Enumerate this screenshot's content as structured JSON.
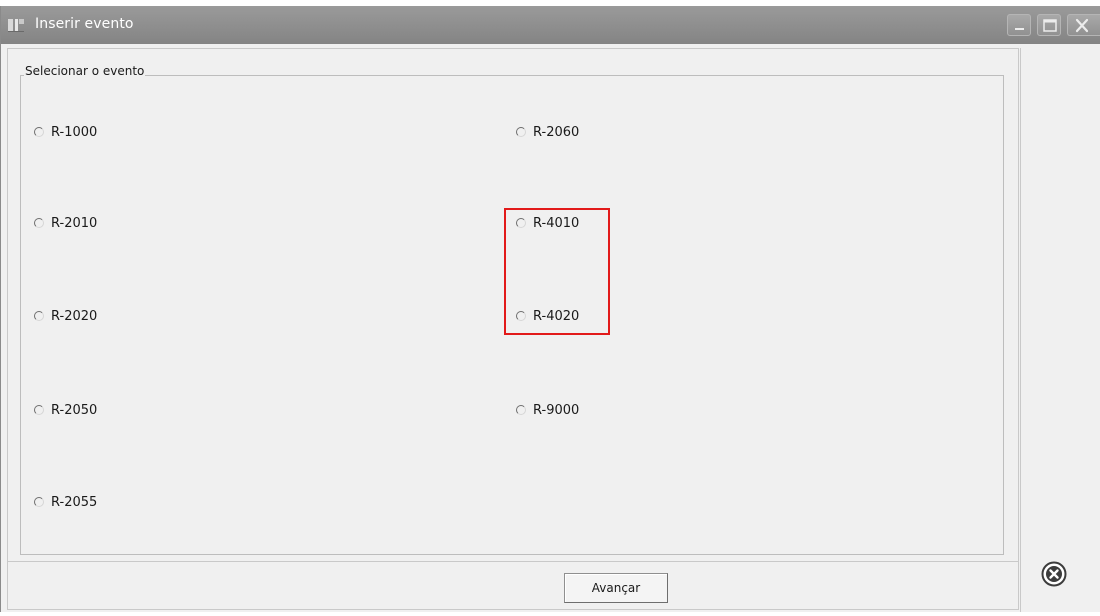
{
  "window": {
    "title": "Inserir evento",
    "icons": {
      "app": "app-logo-icon",
      "minimize": "minimize-icon",
      "maximize": "maximize-icon",
      "close": "close-icon",
      "cancel": "close-circle-icon"
    }
  },
  "group": {
    "legend": "Selecionar o evento"
  },
  "events": {
    "left": [
      {
        "label": "R-1000",
        "selected": false
      },
      {
        "label": "R-2010",
        "selected": false
      },
      {
        "label": "R-2020",
        "selected": false
      },
      {
        "label": "R-2050",
        "selected": false
      },
      {
        "label": "R-2055",
        "selected": false
      }
    ],
    "right": [
      {
        "label": "R-2060",
        "selected": false
      },
      {
        "label": "R-4010",
        "selected": false
      },
      {
        "label": "R-4020",
        "selected": false
      },
      {
        "label": "R-9000",
        "selected": false
      }
    ]
  },
  "footer": {
    "advance_label": "Avançar"
  },
  "colors": {
    "titlebar": "#8d8d8d",
    "highlight": "#e21a1a",
    "background": "#f0f0f0"
  }
}
